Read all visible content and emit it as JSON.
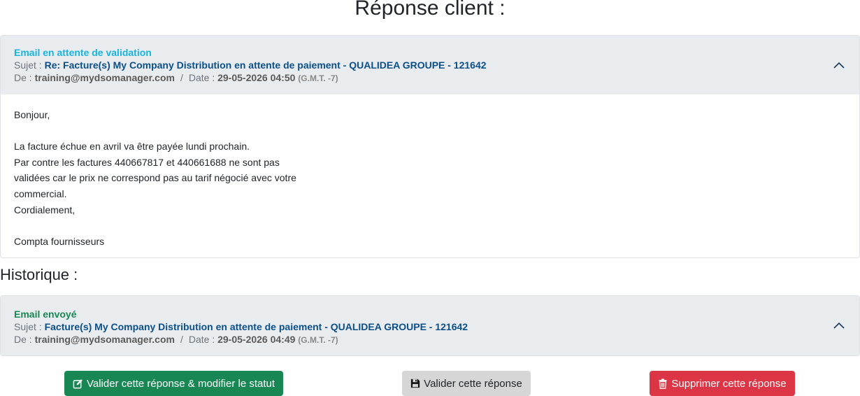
{
  "page": {
    "title": "Réponse client :"
  },
  "reply_card": {
    "status": "Email en attente de validation",
    "subject_label": "Sujet :",
    "subject": "Re: Facture(s) My Company Distribution en attente de paiement - QUALIDEA GROUPE - 121642",
    "from_label": "De :",
    "from": "training@mydsomanager.com",
    "separator": "/",
    "date_label": "Date :",
    "date": "29-05-2026 04:50",
    "timezone": "(G.M.T. -7)",
    "body": {
      "greeting": "Bonjour,",
      "line1": "La facture échue en avril va être payée lundi prochain.",
      "line2": "Par contre les factures 440667817 et 440661688 ne sont pas",
      "line3": "validées car le prix ne correspond pas au tarif négocié avec votre",
      "line4": "commercial.",
      "closing": "Cordialement,",
      "signature": "Compta fournisseurs"
    }
  },
  "history": {
    "title": "Historique :",
    "card": {
      "status": "Email envoyé",
      "subject_label": "Sujet :",
      "subject": "Facture(s) My Company Distribution en attente de paiement - QUALIDEA GROUPE - 121642",
      "from_label": "De :",
      "from": "training@mydsomanager.com",
      "separator": "/",
      "date_label": "Date :",
      "date": "29-05-2026 04:49",
      "timezone": "(G.M.T. -7)"
    }
  },
  "actions": {
    "validate_modify_label": "Valider cette réponse & modifier le statut",
    "validate_label": "Valider cette réponse",
    "delete_label": "Supprimer cette réponse"
  },
  "icons": {
    "validate_modify": "edit-icon",
    "validate": "save-icon",
    "delete": "trash-icon",
    "collapse": "chevron-up-icon"
  },
  "colors": {
    "pending_status": "#17b4e0",
    "sent_status": "#198754",
    "subject": "#0b4f8a",
    "btn_success": "#198754",
    "btn_secondary": "#d6d6d6",
    "btn_danger": "#dc3545",
    "card_header": "#e9ecef"
  }
}
